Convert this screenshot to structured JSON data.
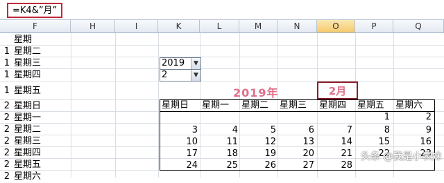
{
  "formula_bar": {
    "text": "=K4&”月”"
  },
  "columns": [
    "F",
    "H",
    "I",
    "K",
    "L",
    "M",
    "N",
    "O",
    "P",
    "Q"
  ],
  "rows": [
    {
      "num": "",
      "f": "星期"
    },
    {
      "num": "1",
      "f": "星期二"
    },
    {
      "num": "1",
      "f": "星期三"
    },
    {
      "num": "1",
      "f": "星期四"
    },
    {
      "num": "1",
      "f": "星期五"
    },
    {
      "num": "2",
      "f": "星期日"
    },
    {
      "num": "2",
      "f": "星期一"
    },
    {
      "num": "2",
      "f": "星期二"
    },
    {
      "num": "2",
      "f": "星期三"
    },
    {
      "num": "2",
      "f": "星期四"
    },
    {
      "num": "2",
      "f": "星期五"
    },
    {
      "num": "2",
      "f": "星期六"
    }
  ],
  "selectors": {
    "year": "2019",
    "month": "2"
  },
  "calendar": {
    "year_title": "2019年",
    "month_title": "2月",
    "weekdays": [
      "星期日",
      "星期一",
      "星期二",
      "星期三",
      "星期四",
      "星期五",
      "星期六"
    ],
    "weeks": [
      [
        "",
        "",
        "",
        "",
        "",
        "1",
        "2"
      ],
      [
        "3",
        "4",
        "5",
        "6",
        "7",
        "8",
        "9"
      ],
      [
        "10",
        "11",
        "12",
        "13",
        "14",
        "15",
        "16"
      ],
      [
        "17",
        "18",
        "19",
        "20",
        "21",
        "22",
        "23"
      ],
      [
        "24",
        "25",
        "26",
        "27",
        "28",
        "",
        ""
      ]
    ]
  },
  "watermark": "头条 @我是小表妹",
  "colors": {
    "highlight_border": "#c0293a",
    "title_pink": "#e0708a",
    "selected_column": "#f5c96b"
  }
}
